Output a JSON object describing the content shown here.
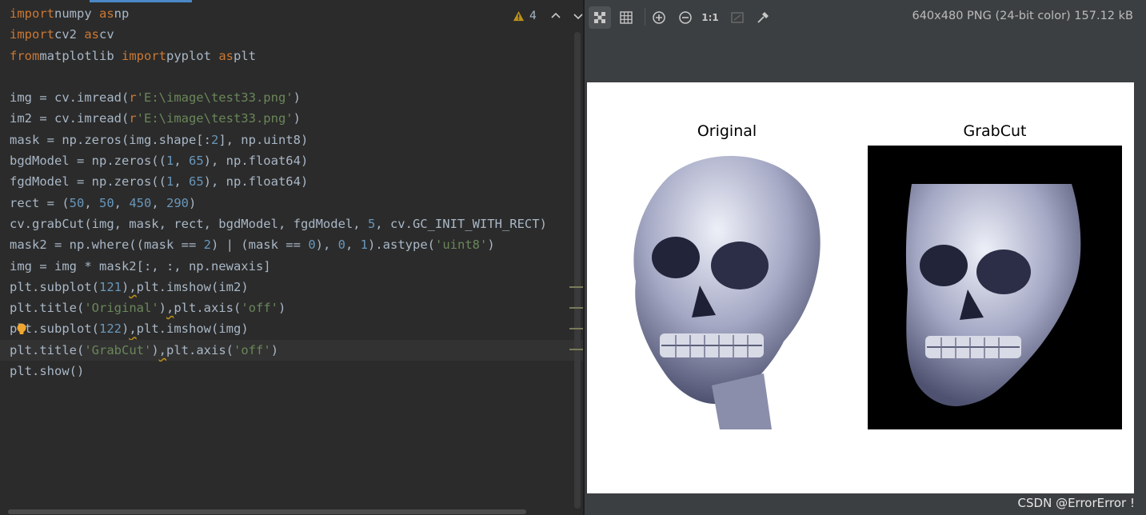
{
  "editor": {
    "inspection": {
      "warning_count": "4"
    },
    "lines": [
      [
        [
          "kw",
          "import"
        ],
        [
          "",
          "numpy "
        ],
        [
          "kw",
          "as"
        ],
        [
          "",
          "np"
        ]
      ],
      [
        [
          "kw",
          "import"
        ],
        [
          "",
          "cv2 "
        ],
        [
          "kw",
          "as"
        ],
        [
          "",
          "cv"
        ]
      ],
      [
        [
          "kw",
          "from"
        ],
        [
          "",
          "matplotlib "
        ],
        [
          "kw",
          "import"
        ],
        [
          "",
          "pyplot "
        ],
        [
          "kw",
          "as"
        ],
        [
          "",
          "plt"
        ]
      ],
      [],
      [
        [
          "",
          "img = cv.imread("
        ],
        [
          "prefix",
          "r"
        ],
        [
          "str",
          "'E:\\image\\test33.png'"
        ],
        [
          "",
          ")"
        ]
      ],
      [
        [
          "",
          "im2 = cv.imread("
        ],
        [
          "prefix",
          "r"
        ],
        [
          "str",
          "'E:\\image\\test33.png'"
        ],
        [
          "",
          ")"
        ]
      ],
      [
        [
          "",
          "mask = np.zeros(img.shape[:"
        ],
        [
          "num",
          "2"
        ],
        [
          "",
          "], np.uint8)"
        ]
      ],
      [
        [
          "",
          "bgdModel = np.zeros(("
        ],
        [
          "num",
          "1"
        ],
        [
          "",
          ", "
        ],
        [
          "num",
          "65"
        ],
        [
          "",
          "), np.float64)"
        ]
      ],
      [
        [
          "",
          "fgdModel = np.zeros(("
        ],
        [
          "num",
          "1"
        ],
        [
          "",
          ", "
        ],
        [
          "num",
          "65"
        ],
        [
          "",
          "), np.float64)"
        ]
      ],
      [
        [
          "",
          "rect = ("
        ],
        [
          "num",
          "50"
        ],
        [
          "",
          ", "
        ],
        [
          "num",
          "50"
        ],
        [
          "",
          ", "
        ],
        [
          "num",
          "450"
        ],
        [
          "",
          ", "
        ],
        [
          "num",
          "290"
        ],
        [
          "",
          ")"
        ]
      ],
      [
        [
          "",
          "cv.grabCut(img, mask, rect, bgdModel, fgdModel, "
        ],
        [
          "num",
          "5"
        ],
        [
          "",
          ", cv.GC_INIT_WITH_RECT)"
        ]
      ],
      [
        [
          "",
          "mask2 = np.where((mask == "
        ],
        [
          "num",
          "2"
        ],
        [
          "",
          ") | (mask == "
        ],
        [
          "num",
          "0"
        ],
        [
          "",
          "), "
        ],
        [
          "num",
          "0"
        ],
        [
          "",
          ", "
        ],
        [
          "num",
          "1"
        ],
        [
          "",
          ").astype("
        ],
        [
          "str",
          "'uint8'"
        ],
        [
          "",
          ")"
        ]
      ],
      [
        [
          "",
          "img = img * mask2[:, :, np.newaxis]"
        ]
      ],
      [
        [
          "",
          "plt.subplot("
        ],
        [
          "num",
          "121"
        ],
        [
          "",
          ")"
        ],
        [
          "dotw",
          ","
        ],
        [
          "",
          "plt.imshow(im2)"
        ]
      ],
      [
        [
          "",
          "plt.title("
        ],
        [
          "str",
          "'Original'"
        ],
        [
          "",
          ")"
        ],
        [
          "dotw",
          ","
        ],
        [
          "",
          "plt.axis("
        ],
        [
          "str",
          "'off'"
        ],
        [
          "",
          ")"
        ]
      ],
      [
        [
          "",
          "plt.subplot("
        ],
        [
          "num",
          "122"
        ],
        [
          "",
          ")"
        ],
        [
          "dotw",
          ","
        ],
        [
          "",
          "plt.imshow(img)"
        ]
      ],
      [
        [
          "",
          "plt.title("
        ],
        [
          "str",
          "'GrabCut'"
        ],
        [
          "",
          ")"
        ],
        [
          "dotw",
          ","
        ],
        [
          "",
          "plt.axis("
        ],
        [
          "str",
          "'off'"
        ],
        [
          "",
          ")"
        ]
      ],
      [
        [
          "",
          "plt.show()"
        ]
      ]
    ],
    "current_line": 16,
    "icons": {
      "warning": "warning-triangle-icon",
      "prev": "chevron-up-icon",
      "next": "chevron-down-icon",
      "intention": "lightbulb-icon"
    },
    "colors": {
      "keyword": "#cc7832",
      "string": "#6a8759",
      "number": "#6897bb",
      "text": "#a9b7c6",
      "background": "#2b2b2b"
    }
  },
  "viewer": {
    "image_info": "640x480 PNG (24-bit color) 157.12 kB",
    "toolbar": {
      "zoom_actual_label": "1:1",
      "icons": [
        "chessboard-icon",
        "grid-icon",
        "zoom-in-icon",
        "zoom-out-icon",
        "actual-size-icon",
        "fit-zoom-icon",
        "color-picker-icon"
      ]
    },
    "figure": {
      "subplot_1_title": "Original",
      "subplot_2_title": "GrabCut"
    },
    "watermark": "CSDN @ErrorError !"
  }
}
